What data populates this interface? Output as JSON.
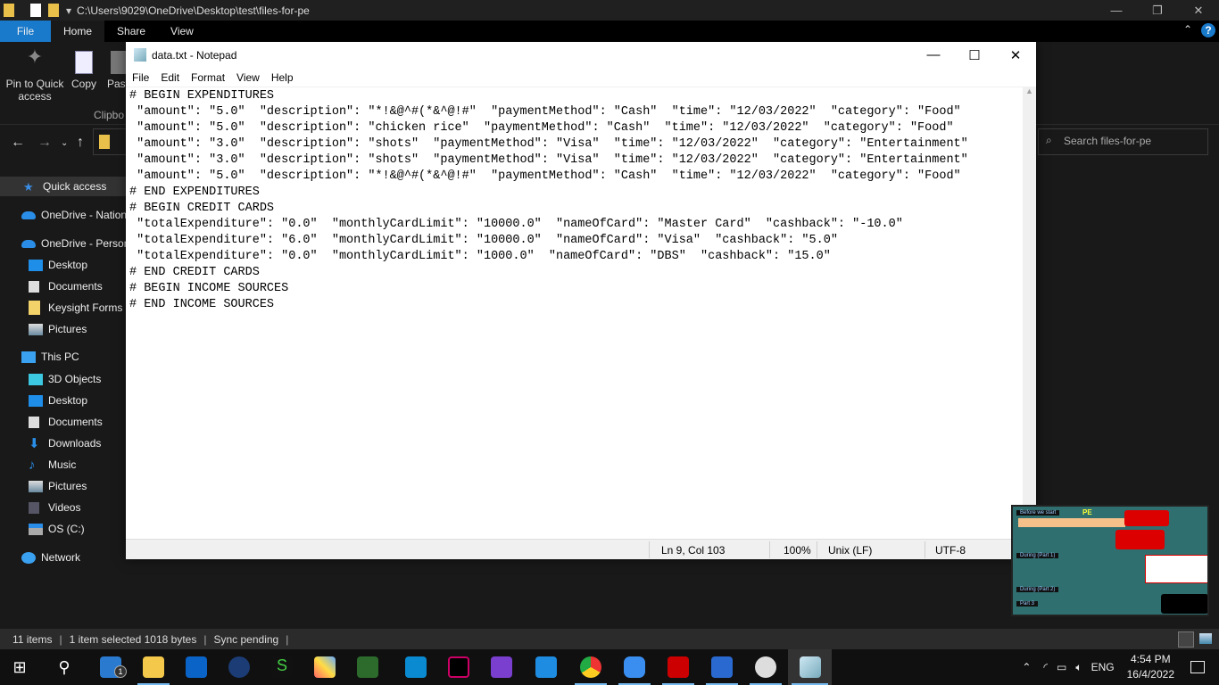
{
  "explorer": {
    "title_path": "C:\\Users\\9029\\OneDrive\\Desktop\\test\\files-for-pe",
    "tabs": [
      "File",
      "Home",
      "Share",
      "View"
    ],
    "ribbon": {
      "pin_label_1": "Pin to Quick",
      "pin_label_2": "access",
      "copy_label": "Copy",
      "paste_label": "Past",
      "group_label": "Clipbo"
    },
    "search_placeholder": "Search files-for-pe",
    "nav": [
      {
        "label": "Quick access",
        "icon": "star-icon"
      },
      {
        "label": "OneDrive - Nation",
        "icon": "cloud-icon"
      },
      {
        "label": "OneDrive - Person",
        "icon": "cloud-icon"
      },
      {
        "label": "Desktop",
        "icon": "desktop-icon"
      },
      {
        "label": "Documents",
        "icon": "documents-icon"
      },
      {
        "label": "Keysight Forms t",
        "icon": "folder-icon"
      },
      {
        "label": "Pictures",
        "icon": "pictures-icon"
      },
      {
        "label": "This PC",
        "icon": "computer-icon"
      },
      {
        "label": "3D Objects",
        "icon": "cube-icon"
      },
      {
        "label": "Desktop",
        "icon": "desktop-icon"
      },
      {
        "label": "Documents",
        "icon": "documents-icon"
      },
      {
        "label": "Downloads",
        "icon": "download-icon"
      },
      {
        "label": "Music",
        "icon": "music-icon"
      },
      {
        "label": "Pictures",
        "icon": "pictures-icon"
      },
      {
        "label": "Videos",
        "icon": "videos-icon"
      },
      {
        "label": "OS (C:)",
        "icon": "drive-icon"
      },
      {
        "label": "Network",
        "icon": "network-icon"
      }
    ],
    "status": {
      "items": "11 items",
      "selected": "1 item selected  1018 bytes",
      "sync": "Sync pending"
    }
  },
  "notepad": {
    "title": "data.txt - Notepad",
    "menu": [
      "File",
      "Edit",
      "Format",
      "View",
      "Help"
    ],
    "lines": [
      "# BEGIN EXPENDITURES",
      " \"amount\": \"5.0\"  \"description\": \"*!&@^#(*&^@!#\"  \"paymentMethod\": \"Cash\"  \"time\": \"12/03/2022\"  \"category\": \"Food\"",
      " \"amount\": \"5.0\"  \"description\": \"chicken rice\"  \"paymentMethod\": \"Cash\"  \"time\": \"12/03/2022\"  \"category\": \"Food\"",
      " \"amount\": \"3.0\"  \"description\": \"shots\"  \"paymentMethod\": \"Visa\"  \"time\": \"12/03/2022\"  \"category\": \"Entertainment\"",
      " \"amount\": \"3.0\"  \"description\": \"shots\"  \"paymentMethod\": \"Visa\"  \"time\": \"12/03/2022\"  \"category\": \"Entertainment\"",
      " \"amount\": \"5.0\"  \"description\": \"*!&@^#(*&^@!#\"  \"paymentMethod\": \"Cash\"  \"time\": \"12/03/2022\"  \"category\": \"Food\"",
      "# END EXPENDITURES",
      "# BEGIN CREDIT CARDS",
      " \"totalExpenditure\": \"0.0\"  \"monthlyCardLimit\": \"10000.0\"  \"nameOfCard\": \"Master Card\"  \"cashback\": \"-10.0\"",
      " \"totalExpenditure\": \"6.0\"  \"monthlyCardLimit\": \"10000.0\"  \"nameOfCard\": \"Visa\"  \"cashback\": \"5.0\"",
      " \"totalExpenditure\": \"0.0\"  \"monthlyCardLimit\": \"1000.0\"  \"nameOfCard\": \"DBS\"  \"cashback\": \"15.0\"",
      "# END CREDIT CARDS",
      "# BEGIN INCOME SOURCES",
      "# END INCOME SOURCES"
    ],
    "status": {
      "position": "Ln 9, Col 103",
      "zoom": "100%",
      "line_ending": "Unix (LF)",
      "encoding": "UTF-8"
    }
  },
  "thumbnail": {
    "title": "PE",
    "sections": [
      "Before we start",
      "During (Part 1)",
      "During (Part 2)",
      "Part 3"
    ]
  },
  "taskbar": {
    "time": "4:54 PM",
    "date": "16/4/2022",
    "language": "ENG",
    "badge": "1"
  },
  "colors": {
    "accent": "#1979ca",
    "explorer_bg": "#191919",
    "taskbar_bg": "#101010"
  }
}
